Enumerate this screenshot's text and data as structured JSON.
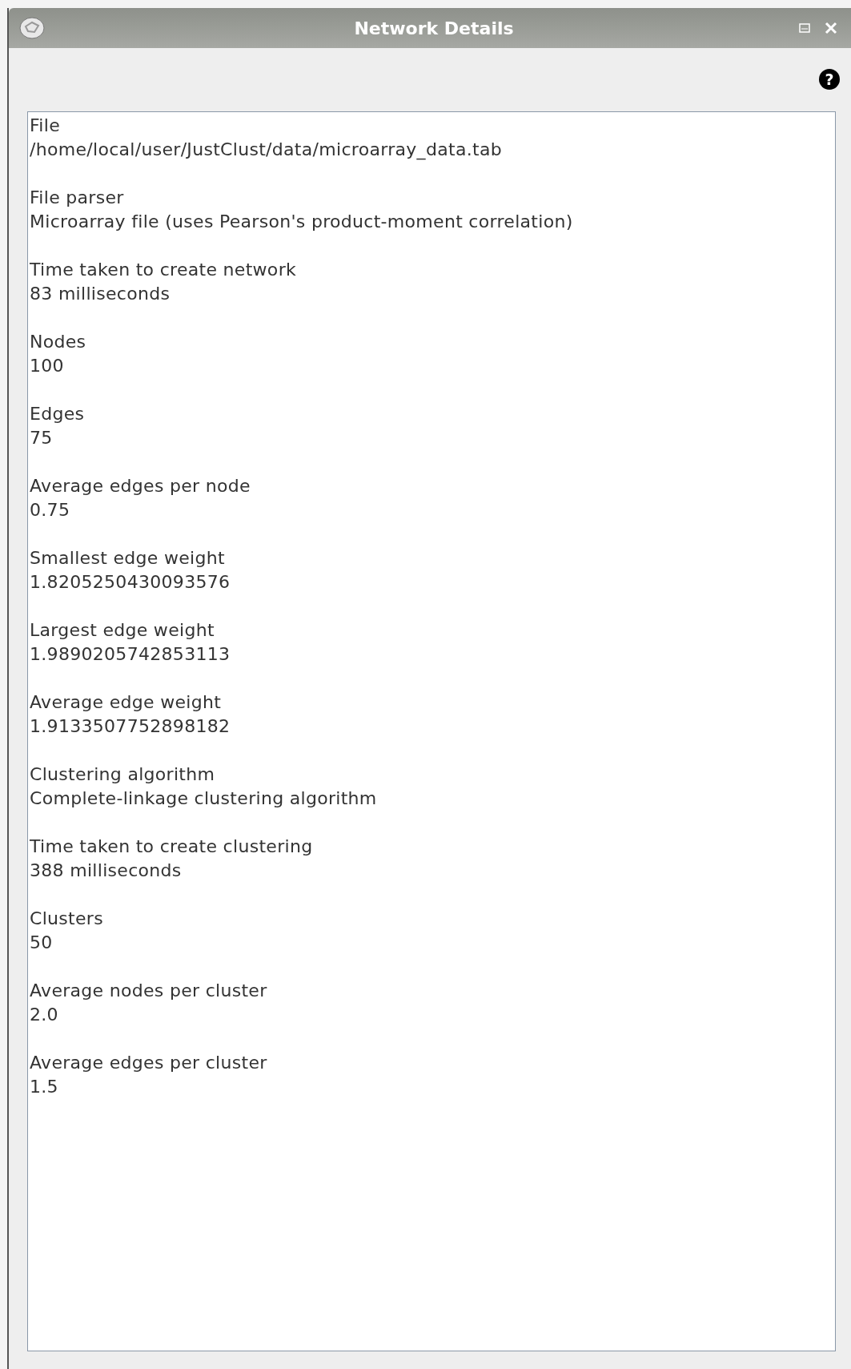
{
  "window": {
    "title": "Network Details"
  },
  "help": {
    "glyph": "?"
  },
  "details": [
    {
      "label": "File",
      "value": "/home/local/user/JustClust/data/microarray_data.tab"
    },
    {
      "label": "File parser",
      "value": "Microarray file (uses Pearson's product-moment correlation)"
    },
    {
      "label": "Time taken to create network",
      "value": "83 milliseconds"
    },
    {
      "label": "Nodes",
      "value": "100"
    },
    {
      "label": "Edges",
      "value": "75"
    },
    {
      "label": "Average edges per node",
      "value": "0.75"
    },
    {
      "label": "Smallest edge weight",
      "value": "1.8205250430093576"
    },
    {
      "label": "Largest edge weight",
      "value": "1.9890205742853113"
    },
    {
      "label": "Average edge weight",
      "value": "1.9133507752898182"
    },
    {
      "label": "Clustering algorithm",
      "value": "Complete-linkage clustering algorithm"
    },
    {
      "label": "Time taken to create clustering",
      "value": "388 milliseconds"
    },
    {
      "label": "Clusters",
      "value": "50"
    },
    {
      "label": "Average nodes per cluster",
      "value": "2.0"
    },
    {
      "label": "Average edges per cluster",
      "value": "1.5"
    }
  ]
}
